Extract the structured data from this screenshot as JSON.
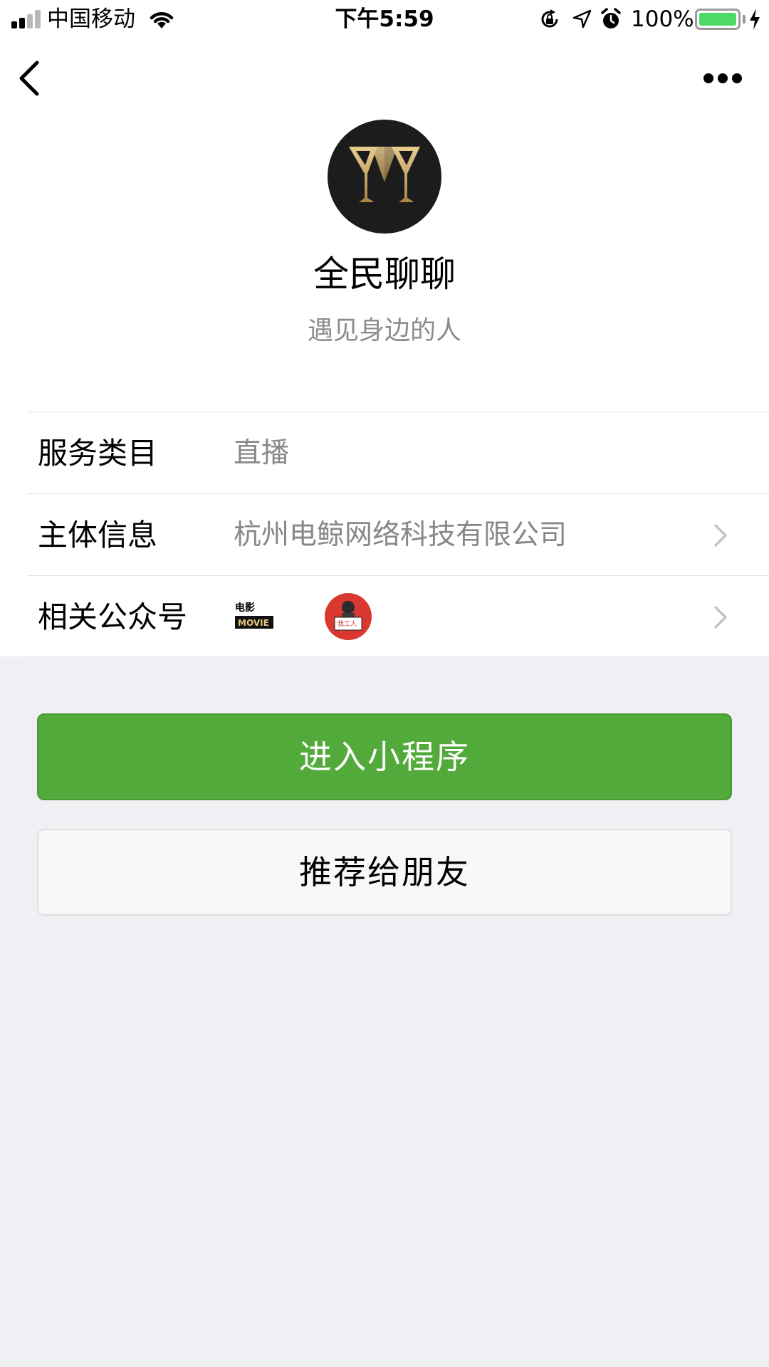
{
  "status_bar": {
    "carrier": "中国移动",
    "time": "下午5:59",
    "battery_percent": "100%",
    "battery_level": 1.0,
    "signal_bars": 2
  },
  "nav": {
    "back_icon": "chevron-left-icon",
    "more_icon": "ellipsis-icon"
  },
  "app": {
    "name": "全民聊聊",
    "description": "遇见身边的人",
    "logo_icon": "wine-glass-logo"
  },
  "info_rows": [
    {
      "label": "服务类目",
      "value": "直播"
    },
    {
      "label": "主体信息",
      "value": "杭州电鲸网络科技有限公司"
    },
    {
      "label": "相关公众号",
      "value": ""
    }
  ],
  "related_accounts": {
    "movie_label": "MOVIE",
    "movie_header": "电影",
    "worker_label": "我工人"
  },
  "buttons": {
    "enter": "进入小程序",
    "share": "推荐给朋友"
  },
  "colors": {
    "primary": "#51aa3a",
    "background": "#efeff4",
    "battery": "#4cd964"
  }
}
